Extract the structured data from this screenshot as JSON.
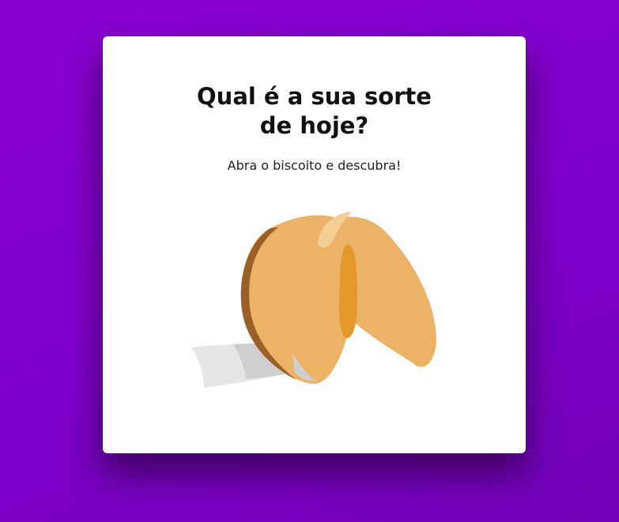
{
  "card": {
    "title": "Qual é a sua sorte de hoje?",
    "subtitle": "Abra o biscoito e descubra!"
  },
  "cookie": {
    "icon": "fortune-cookie-icon",
    "colors": {
      "dough": "#ecb265",
      "dough_dark": "#e5992c",
      "edge": "#9a6028",
      "paper": "#e6e6e6",
      "paper_shade": "#cfcfcf"
    }
  },
  "background": {
    "gradient_start": "#8a00cf",
    "gradient_end": "#7200b8"
  }
}
